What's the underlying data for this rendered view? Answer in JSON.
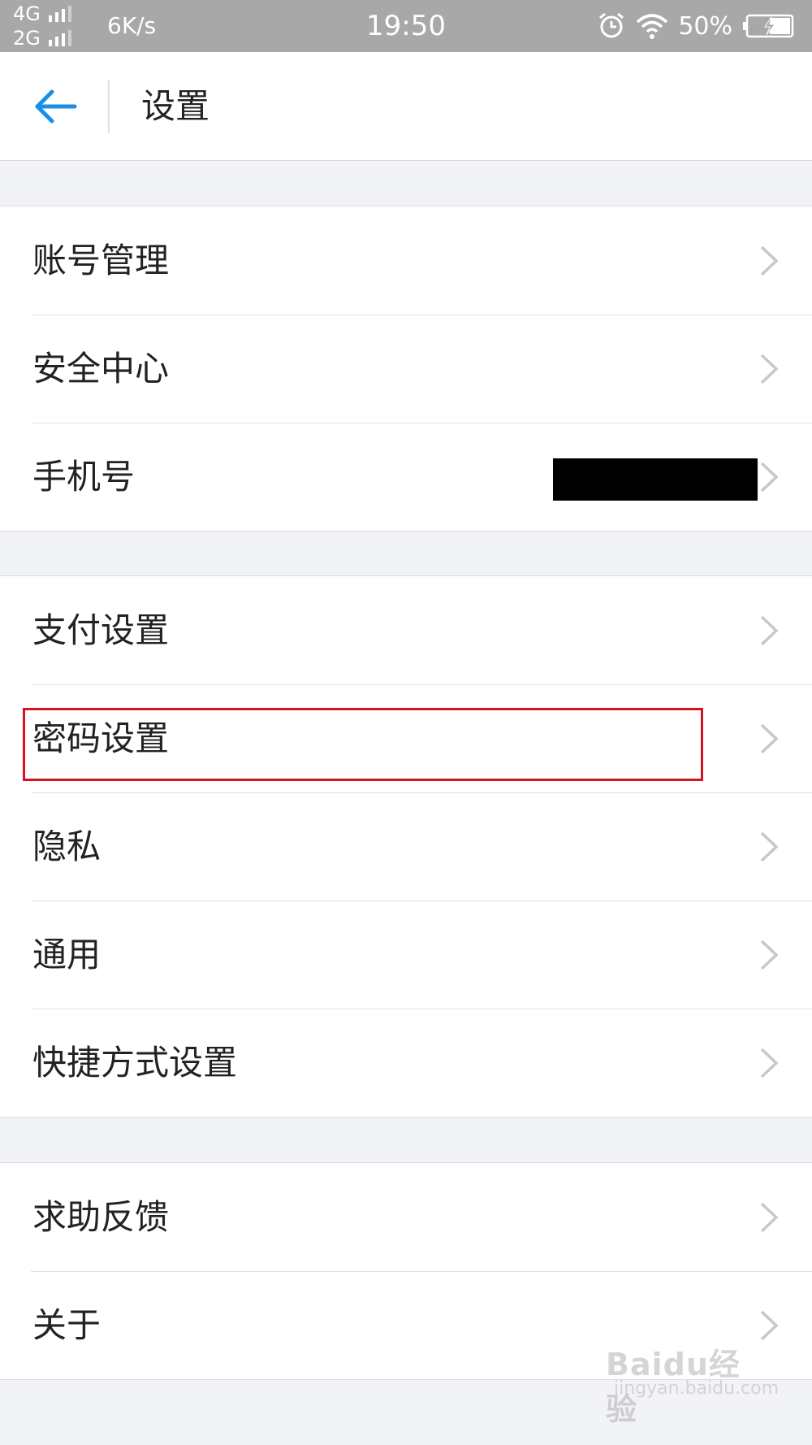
{
  "status_bar": {
    "net1": "4G",
    "net2": "2G",
    "speed": "6K/s",
    "time": "19:50",
    "battery_pct": "50%"
  },
  "header": {
    "title": "设置"
  },
  "groups": [
    {
      "items": [
        {
          "label": "账号管理"
        },
        {
          "label": "安全中心"
        },
        {
          "label": "手机号"
        }
      ]
    },
    {
      "items": [
        {
          "label": "支付设置"
        },
        {
          "label": "密码设置"
        },
        {
          "label": "隐私"
        },
        {
          "label": "通用"
        },
        {
          "label": "快捷方式设置"
        }
      ]
    },
    {
      "items": [
        {
          "label": "求助反馈"
        },
        {
          "label": "关于"
        }
      ]
    }
  ],
  "watermark": {
    "main": "Baidu经验",
    "sub": "jingyan.baidu.com"
  },
  "colors": {
    "accent": "#1a8fe3",
    "highlight": "#d4141e",
    "status_bar": "#a8a8a8"
  }
}
